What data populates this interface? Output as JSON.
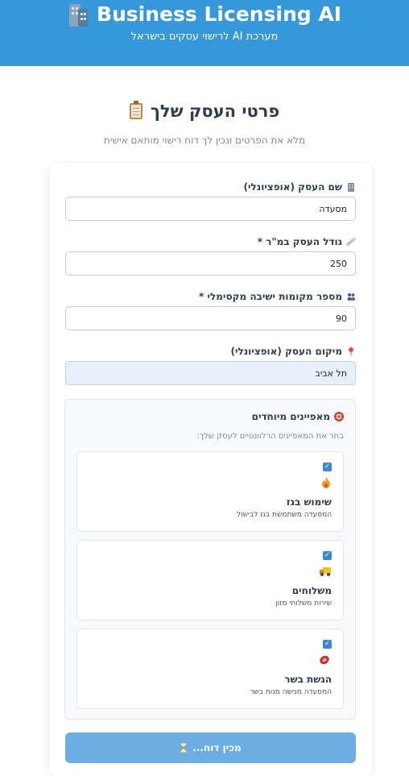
{
  "header": {
    "title": "Business Licensing AI",
    "subtitle": "מערכת AI לרישוי עסקים בישראל",
    "icon": "building-icon"
  },
  "form": {
    "title": "פרטי העסק שלך",
    "title_icon": "clipboard-icon",
    "subtitle": "מלא את הפרטים ונכין לך דוח רישוי מותאם אישית",
    "fields": [
      {
        "label": "שם העסק (אופציונלי)",
        "icon": "office-icon",
        "value": "מסעדה"
      },
      {
        "label": "גודל העסק במ\"ר *",
        "icon": "ruler-icon",
        "value": "250"
      },
      {
        "label": "מספר מקומות ישיבה מקסימלי *",
        "icon": "people-icon",
        "value": "90"
      },
      {
        "label": "מיקום העסק (אופציונלי)",
        "icon": "pin-icon",
        "value": "תל אביב"
      }
    ]
  },
  "features": {
    "title": "מאפיינים מיוחדים",
    "title_icon": "target-icon",
    "subtitle": "בחר את המאפיינים הרלוונטיים לעסק שלך:",
    "items": [
      {
        "name": "שימוש בגז",
        "desc": "המסעדה משתמשת בגז לבישול",
        "icon": "fire-icon",
        "checked": true
      },
      {
        "name": "משלוחים",
        "desc": "שירות משלוחי מזון",
        "icon": "truck-icon",
        "checked": true
      },
      {
        "name": "הגשת בשר",
        "desc": "המסעדה מגישה מנות בשר",
        "icon": "meat-icon",
        "checked": true
      }
    ]
  },
  "submit": {
    "label": "מכין דוח...",
    "icon": "hourglass-icon"
  },
  "colors": {
    "header_bg": "#3498db",
    "button_bg": "#6aaee4",
    "checkbox": "#3a87d6"
  }
}
